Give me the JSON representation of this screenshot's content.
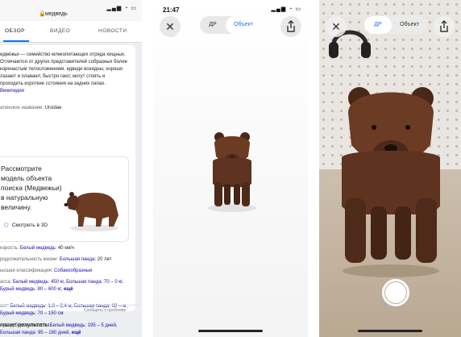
{
  "panel1": {
    "url": "медведь",
    "tabs": [
      "ОБЗОР",
      "ВИДЕО",
      "НОВОСТИ"
    ],
    "description": "едвéжьи — семейство млекопитающих отряда хищных. Отличаются от других представителей собразных более коренастым телосложением. едведи всеядны, хорошо лазают и плавают, быстро гают, могут стоять и проходить короткие сстояния на задних лапах.",
    "description_link": "Википедия",
    "latin_label": "атинское название:",
    "latin_value": "Ursidae",
    "ar_prompt": "Рассмотрите модель объекта поиска (Медвежьи) в натуральную величину.",
    "view_3d": "Смотреть в 3D",
    "speed_label": "корость:",
    "speed_link": "Белый медведь",
    "speed_value": ": 40 км/ч",
    "lifespan_label": "родолжительность жизни:",
    "lifespan_link": "Большая панда",
    "lifespan_value": ": 20 лет",
    "class_label": "ысшая классификация:",
    "class_link": "Собакообразные",
    "mass_label": "асса:",
    "mass_text": "Белый медведь: 450 кг, Большая панда: 70 – 0 кг, Бурый медведь: 80 – 600 кг,",
    "mass_more": "ещё",
    "height_label": "ост:",
    "height_text": "Белый медведь: 1,8 – 2,4 м, Большая панда: 60 – м, Бурый медведь: 70 – 150 см",
    "gestation_label": "ериод беременности:",
    "gestation_text": "Белый медведь: 195 – 5 дней, Большая панда: 95 – 160 дней,",
    "gestation_more": "ещё",
    "report": "Сообщить о проблеме",
    "more_results": "учшие результаты"
  },
  "panel2": {
    "time": "21:47",
    "mode_ar": "ДР",
    "mode_object": "Объект"
  },
  "panel3": {
    "mode_ar": "ДР",
    "mode_object": "Объект"
  },
  "colors": {
    "link": "#1a0dab",
    "accent": "#1a73e8",
    "bear": "#5a3321"
  },
  "icons": [
    "close-icon",
    "share-icon",
    "lock-icon",
    "cube-3d-icon",
    "wifi-icon",
    "battery-icon",
    "shutter-icon"
  ]
}
